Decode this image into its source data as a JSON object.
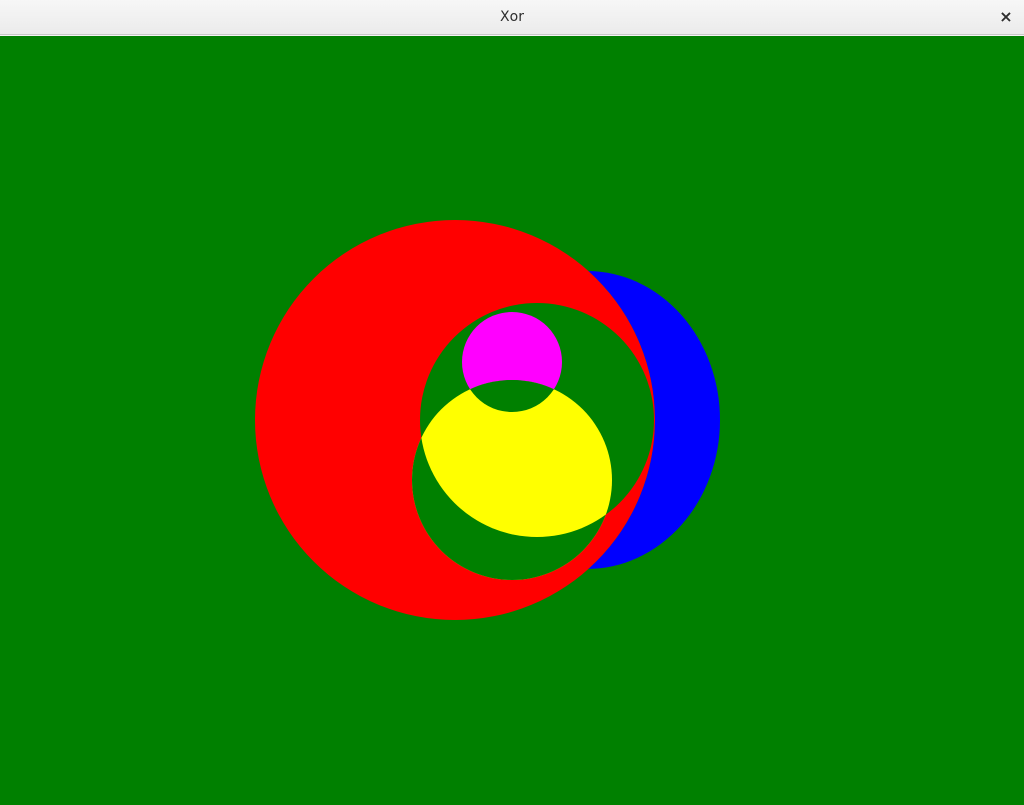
{
  "window": {
    "title": "Xor",
    "close_glyph": "×",
    "close_icon": "close-icon"
  },
  "canvas": {
    "blend_mode": "xor",
    "colors": {
      "background": "#008000",
      "red": "#ff0000",
      "blue": "#0000ff",
      "yellow": "#ffff00",
      "magenta": "#ff00ff"
    }
  }
}
